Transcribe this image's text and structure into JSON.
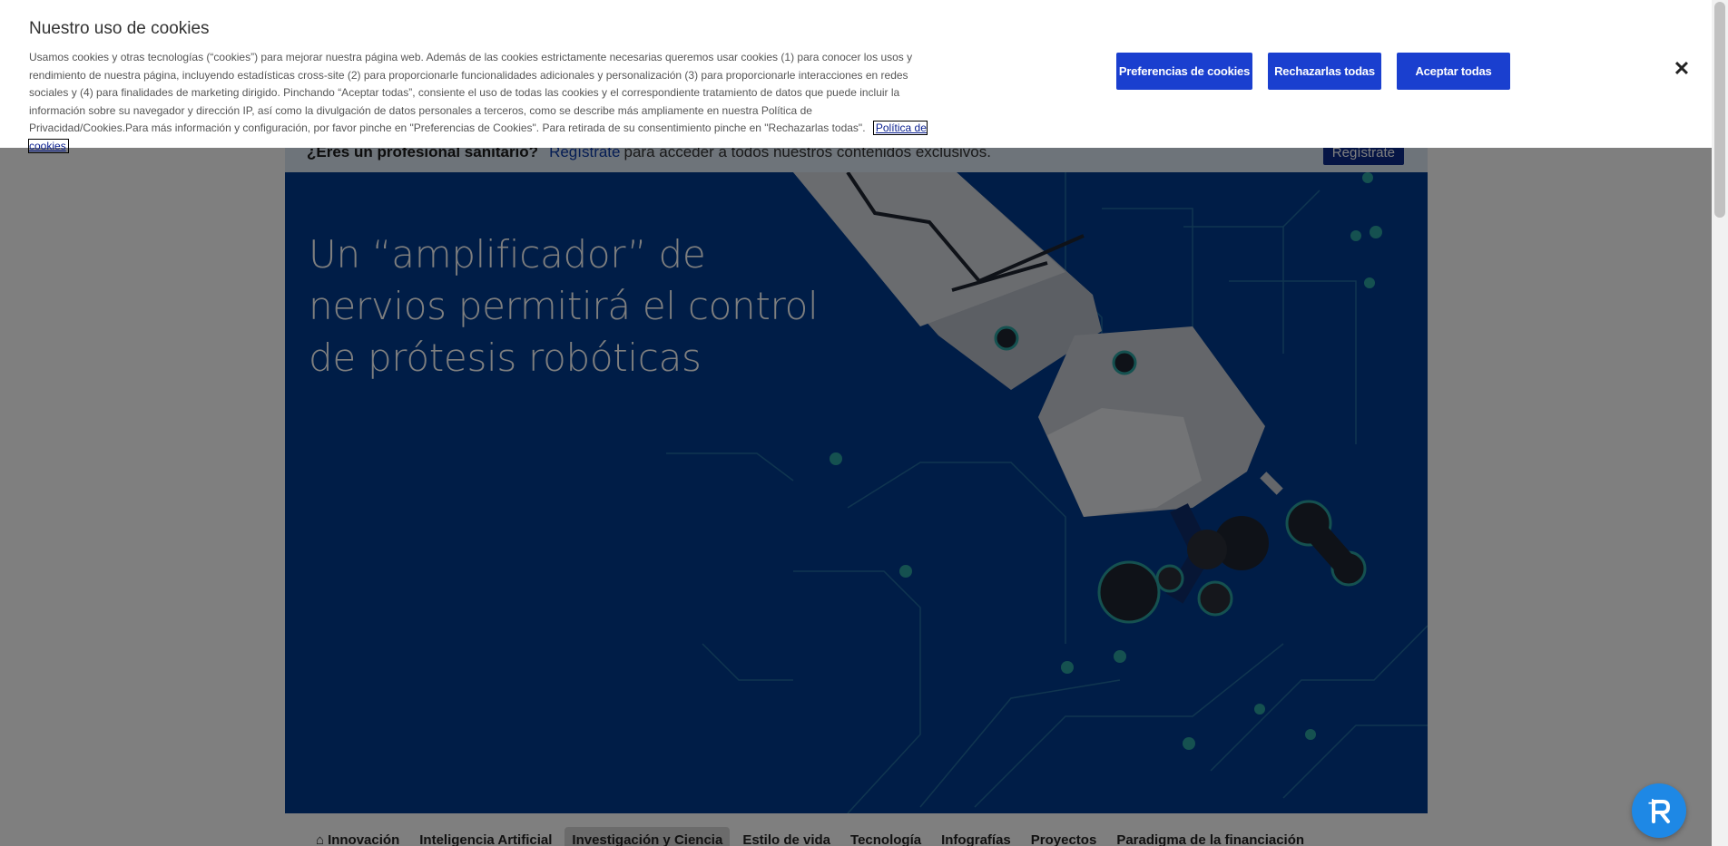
{
  "cookie_banner": {
    "title": "Nuestro uso de cookies",
    "body": "Usamos cookies y otras tecnologías (“cookies”) para mejorar nuestra página web. Además de las cookies estrictamente necesarias queremos usar cookies (1) para conocer los usos y rendimiento de nuestra página, incluyendo estadísticas cross-site (2) para proporcionarle funcionalidades adicionales y personalización (3) para proporcionarle interacciones en redes sociales y (4) para finalidades de marketing dirigido. Pinchando “Aceptar todas”, consiente el uso de todas las cookies y el correspondiente tratamiento de datos que puede incluir la información sobre su navegador y dirección IP, así como la divulgación de datos personales a terceros, como se describe más ampliamente en nuestra Política de Privacidad/Cookies.Para más información y configuración, por favor pinche en \"Preferencias de Cookies\". Para retirada de su consentimiento pinche en \"Rechazarlas todas\".",
    "policy_link": "Política de cookies",
    "preferences_button": "Preferencias de cookies",
    "reject_button": "Rechazarlas todas",
    "accept_button": "Aceptar todas",
    "close_icon": "close-icon",
    "button_color": "#1a3fcf"
  },
  "pro_bar": {
    "question": "¿Eres un profesional sanitario?",
    "link": "Regístrate",
    "rest": "para acceder a todos nuestros contenidos exclusivos.",
    "button": "Regístrate"
  },
  "hero": {
    "title": "Un “amplificador” de nervios permitirá el control de prótesis robóticas",
    "background_color": "#003b8e"
  },
  "nav": {
    "items": [
      {
        "label": "Innovación",
        "icon": "home-icon"
      },
      {
        "label": "Inteligencia Artificial"
      },
      {
        "label": "Investigación y Ciencia",
        "active": true
      },
      {
        "label": "Estilo de vida"
      },
      {
        "label": "Tecnología"
      },
      {
        "label": "Infografías"
      },
      {
        "label": "Proyectos"
      },
      {
        "label": "Paradigma de la financiación"
      }
    ]
  },
  "widget": {
    "icon": "accessibility-icon"
  }
}
